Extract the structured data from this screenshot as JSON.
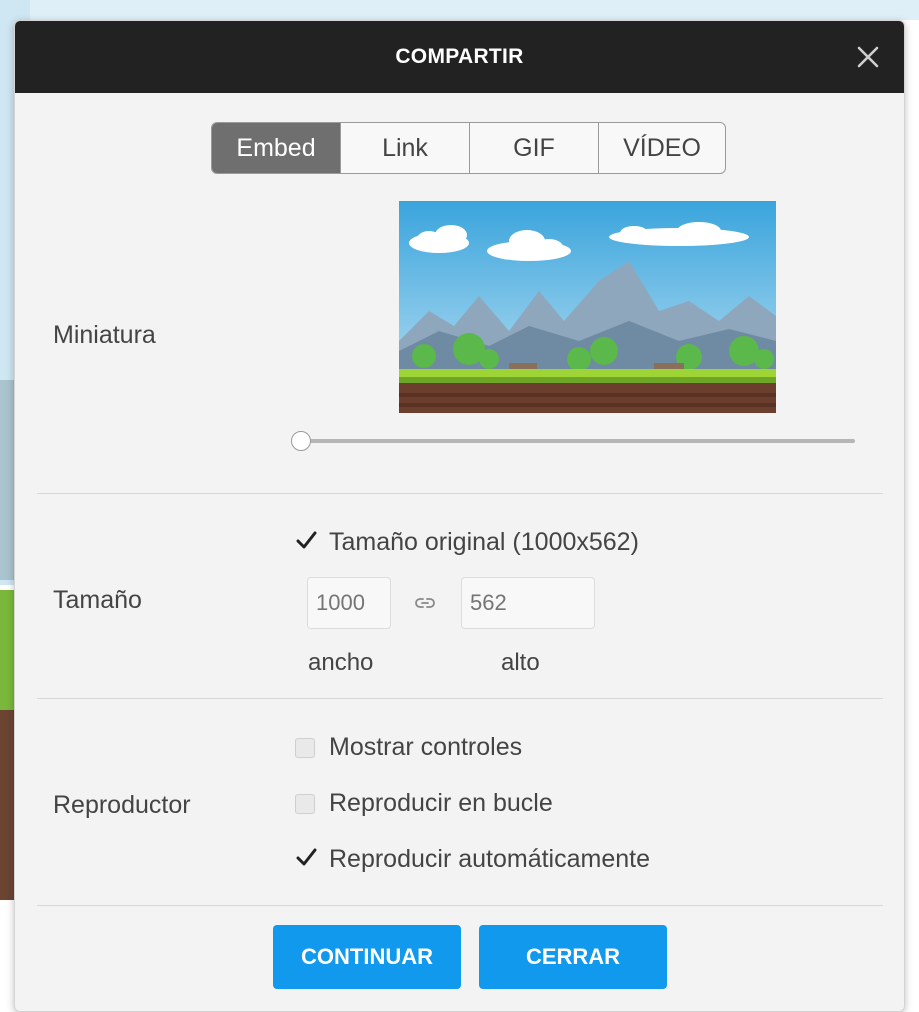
{
  "modal": {
    "title": "COMPARTIR",
    "close_icon": "close-icon"
  },
  "tabs": [
    {
      "label": "Embed",
      "active": true
    },
    {
      "label": "Link",
      "active": false
    },
    {
      "label": "GIF",
      "active": false
    },
    {
      "label": "VÍDEO",
      "active": false
    }
  ],
  "thumbnail": {
    "label": "Miniatura",
    "slider_value": 0
  },
  "size": {
    "label": "Tamaño",
    "original_checkbox": {
      "label": "Tamaño original (1000x562)",
      "checked": true
    },
    "width_placeholder": "1000",
    "height_placeholder": "562",
    "width_label": "ancho",
    "height_label": "alto",
    "link_icon": "link-icon"
  },
  "player": {
    "label": "Reproductor",
    "options": [
      {
        "label": "Mostrar controles",
        "checked": false
      },
      {
        "label": "Reproducir en bucle",
        "checked": false
      },
      {
        "label": "Reproducir automáticamente",
        "checked": true
      }
    ]
  },
  "buttons": {
    "continue_label": "CONTINUAR",
    "close_label": "CERRAR"
  },
  "colors": {
    "header_bg": "#222222",
    "accent": "#1199ee",
    "active_tab": "#6f6f6f"
  }
}
